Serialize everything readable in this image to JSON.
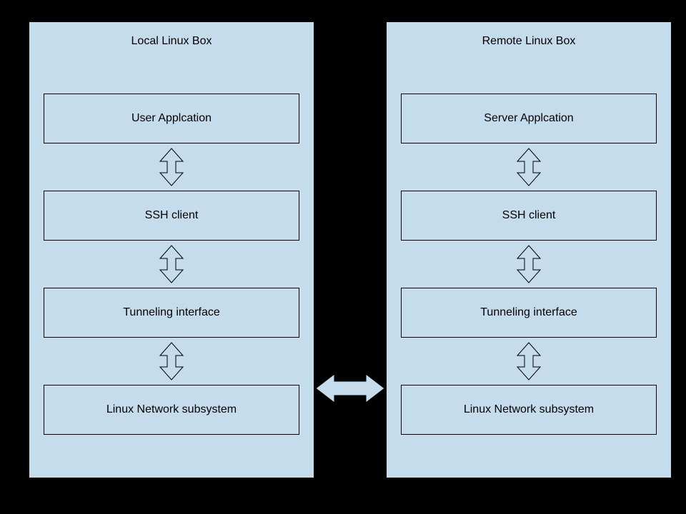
{
  "columns": {
    "left": {
      "title": "Local Linux Box",
      "nodes": {
        "n1": "User Applcation",
        "n2": "SSH client",
        "n3": "Tunneling interface",
        "n4": "Linux Network subsystem"
      }
    },
    "right": {
      "title": "Remote Linux Box",
      "nodes": {
        "n1": "Server Applcation",
        "n2": "SSH client",
        "n3": "Tunneling interface",
        "n4": "Linux Network subsystem"
      }
    }
  },
  "colors": {
    "panel_fill": "#c5dcec",
    "page_bg": "#000000",
    "stroke": "#000000"
  }
}
